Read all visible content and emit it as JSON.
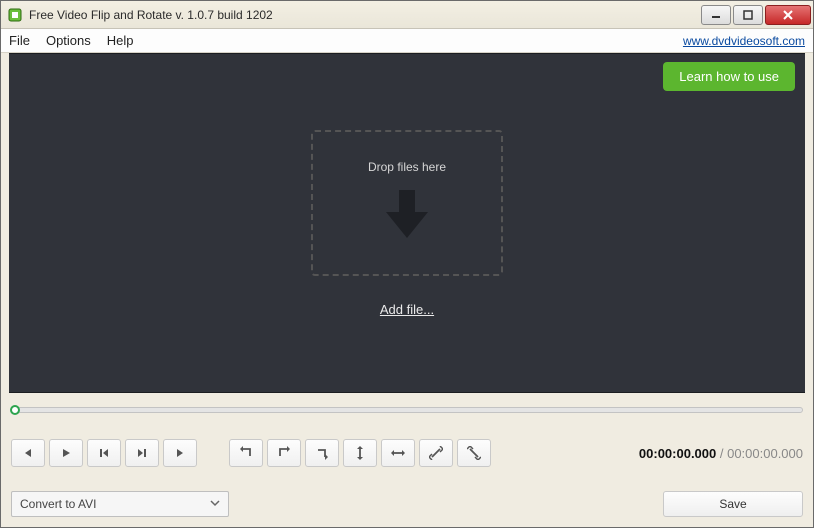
{
  "window": {
    "title": "Free Video Flip and Rotate v. 1.0.7 build 1202"
  },
  "menubar": {
    "file": "File",
    "options": "Options",
    "help": "Help",
    "link": "www.dvdvideosoft.com"
  },
  "stage": {
    "learn": "Learn how to use",
    "drop": "Drop files here",
    "addfile": "Add file..."
  },
  "time": {
    "current": "00:00:00.000",
    "sep": " / ",
    "total": "00:00:00.000"
  },
  "format": {
    "selected": "Convert to AVI"
  },
  "actions": {
    "save": "Save"
  }
}
